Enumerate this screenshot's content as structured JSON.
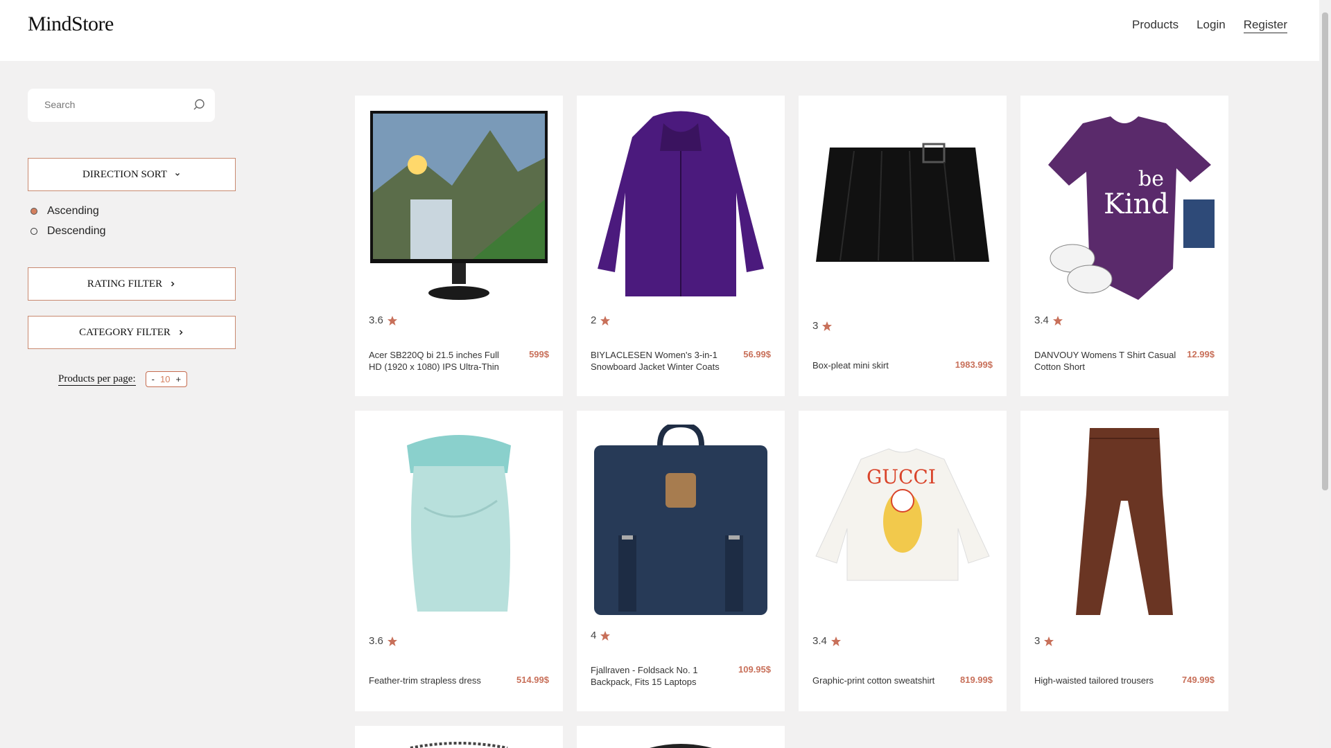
{
  "header": {
    "logo": "MindStore",
    "nav": {
      "products": "Products",
      "login": "Login",
      "register": "Register"
    }
  },
  "sidebar": {
    "search_placeholder": "Search",
    "direction_sort": "DIRECTION SORT",
    "sort_options": {
      "ascending": "Ascending",
      "descending": "Descending",
      "selected": "Ascending"
    },
    "rating_filter": "RATING FILTER",
    "category_filter": "CATEGORY FILTER",
    "per_page_label": "Products per page:",
    "per_page": {
      "minus": "-",
      "value": "10",
      "plus": "+"
    }
  },
  "products": [
    {
      "rating": "3.6",
      "name": "Acer SB220Q bi 21.5 inches Full HD (1920 x 1080) IPS Ultra-Thin",
      "price": "599$"
    },
    {
      "rating": "2",
      "name": "BIYLACLESEN Women's 3-in-1 Snowboard Jacket Winter Coats",
      "price": "56.99$"
    },
    {
      "rating": "3",
      "name": "Box-pleat mini skirt",
      "price": "1983.99$"
    },
    {
      "rating": "3.4",
      "name": "DANVOUY Womens T Shirt Casual Cotton Short",
      "price": "12.99$"
    },
    {
      "rating": "3.6",
      "name": "Feather-trim strapless dress",
      "price": "514.99$"
    },
    {
      "rating": "4",
      "name": "Fjallraven - Foldsack No. 1 Backpack, Fits 15 Laptops",
      "price": "109.95$"
    },
    {
      "rating": "3.4",
      "name": "Graphic-print cotton sweatshirt",
      "price": "819.99$"
    },
    {
      "rating": "3",
      "name": "High-waisted tailored trousers",
      "price": "749.99$"
    }
  ],
  "colors": {
    "accent": "#c8705a",
    "background": "#f2f1f1"
  }
}
